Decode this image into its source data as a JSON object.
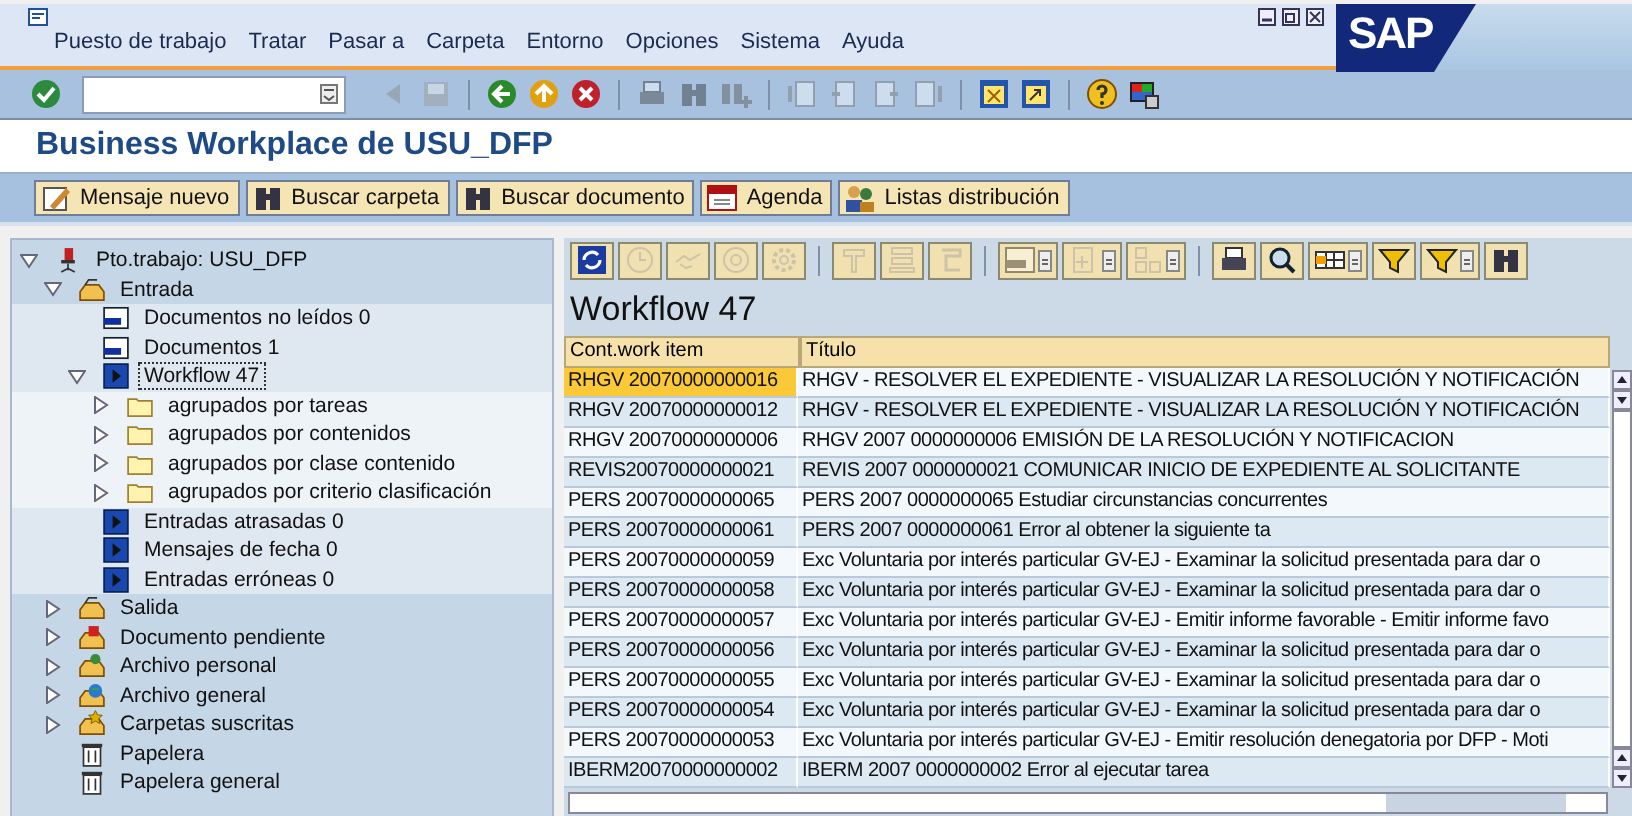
{
  "menu_bar": {
    "items": [
      "Puesto de trabajo",
      "Tratar",
      "Pasar a",
      "Carpeta",
      "Entorno",
      "Opciones",
      "Sistema",
      "Ayuda"
    ],
    "logo": "SAP"
  },
  "main_toolbar": [
    {
      "kind": "button",
      "disabled": false
    },
    {
      "kind": "command_field"
    },
    {
      "kind": "button",
      "disabled": true
    },
    {
      "kind": "button",
      "disabled": true
    },
    {
      "kind": "separator"
    },
    {
      "kind": "button",
      "disabled": false
    },
    {
      "kind": "button",
      "disabled": false
    },
    {
      "kind": "button",
      "disabled": false
    },
    {
      "kind": "separator"
    },
    {
      "kind": "button",
      "disabled": true
    },
    {
      "kind": "button",
      "disabled": true
    },
    {
      "kind": "button",
      "disabled": true
    },
    {
      "kind": "separator"
    },
    {
      "kind": "button",
      "disabled": true
    },
    {
      "kind": "button",
      "disabled": true
    },
    {
      "kind": "button",
      "disabled": true
    },
    {
      "kind": "button",
      "disabled": true
    },
    {
      "kind": "separator"
    },
    {
      "kind": "button",
      "disabled": false
    },
    {
      "kind": "button",
      "disabled": false
    },
    {
      "kind": "separator"
    },
    {
      "kind": "button",
      "disabled": false
    },
    {
      "kind": "button",
      "disabled": false
    }
  ],
  "screen_title": "Business Workplace de USU_DFP",
  "app_toolbar": [
    {
      "label": "Mensaje nuevo"
    },
    {
      "label": "Buscar carpeta"
    },
    {
      "label": "Buscar documento"
    },
    {
      "label": "Agenda"
    },
    {
      "label": "Listas distribución"
    }
  ],
  "tree": [
    {
      "label": "Pto.trabajo: USU_DFP",
      "kind": "workplace",
      "expanded": true,
      "selected": false,
      "children": [
        {
          "label": "Entrada",
          "kind": "inbox",
          "expanded": true,
          "selected": false,
          "children": [
            {
              "label": "Documentos no leídos 0",
              "kind": "document",
              "selected": false
            },
            {
              "label": "Documentos 1",
              "kind": "document",
              "selected": false
            },
            {
              "label": "Workflow 47",
              "kind": "workflow",
              "expanded": true,
              "selected": true,
              "children": [
                {
                  "label": "agrupados por tareas",
                  "kind": "folder",
                  "expanded": false,
                  "selected": false
                },
                {
                  "label": "agrupados por contenidos",
                  "kind": "folder",
                  "expanded": false,
                  "selected": false
                },
                {
                  "label": "agrupados por clase contenido",
                  "kind": "folder",
                  "expanded": false,
                  "selected": false
                },
                {
                  "label": "agrupados por criterio clasificación",
                  "kind": "folder",
                  "expanded": false,
                  "selected": false
                }
              ]
            },
            {
              "label": "Entradas atrasadas 0",
              "kind": "workflow",
              "selected": false
            },
            {
              "label": "Mensajes de fecha 0",
              "kind": "workflow",
              "selected": false
            },
            {
              "label": "Entradas erróneas 0",
              "kind": "workflow",
              "selected": false
            }
          ]
        },
        {
          "label": "Salida",
          "kind": "outbox",
          "expanded": false,
          "selected": false
        },
        {
          "label": "Documento pendiente",
          "kind": "pending",
          "expanded": false,
          "selected": false
        },
        {
          "label": "Archivo personal",
          "kind": "personal",
          "expanded": false,
          "selected": false
        },
        {
          "label": "Archivo general",
          "kind": "general",
          "expanded": false,
          "selected": false
        },
        {
          "label": "Carpetas suscritas",
          "kind": "subscribed",
          "expanded": false,
          "selected": false
        },
        {
          "label": "Papelera",
          "kind": "trash",
          "selected": false
        },
        {
          "label": "Papelera general",
          "kind": "trash",
          "selected": false
        }
      ]
    }
  ],
  "panel": {
    "toolbar": [
      [
        {
          "disabled": false,
          "menu": false
        },
        {
          "disabled": true,
          "menu": false
        },
        {
          "disabled": true,
          "menu": false
        },
        {
          "disabled": true,
          "menu": false
        },
        {
          "disabled": true,
          "menu": false
        }
      ],
      [
        {
          "disabled": true,
          "menu": false
        },
        {
          "disabled": true,
          "menu": false
        },
        {
          "disabled": true,
          "menu": false
        }
      ],
      [
        {
          "disabled": true,
          "menu": true
        },
        {
          "disabled": true,
          "menu": true
        },
        {
          "disabled": true,
          "menu": true
        }
      ],
      [
        {
          "disabled": false,
          "menu": false
        },
        {
          "disabled": false,
          "menu": false
        },
        {
          "disabled": false,
          "menu": true
        },
        {
          "disabled": false,
          "menu": false
        },
        {
          "disabled": false,
          "menu": true
        },
        {
          "disabled": false,
          "menu": false
        }
      ]
    ],
    "title": "Workflow 47",
    "columns": [
      "Cont.work item",
      "Título"
    ],
    "rows": [
      {
        "cells": [
          "RHGV 20070000000016",
          "RHGV - RESOLVER EL EXPEDIENTE - VISUALIZAR LA RESOLUCIÓN Y NOTIFICACIÓN"
        ],
        "selected": true
      },
      {
        "cells": [
          "RHGV 20070000000012",
          "RHGV - RESOLVER EL EXPEDIENTE - VISUALIZAR LA RESOLUCIÓN Y NOTIFICACIÓN"
        ],
        "selected": false
      },
      {
        "cells": [
          "RHGV 20070000000006",
          "RHGV 2007 0000000006 EMISIÓN DE LA RESOLUCIÓN Y NOTIFICACION"
        ],
        "selected": false
      },
      {
        "cells": [
          "REVIS20070000000021",
          "REVIS 2007 0000000021 COMUNICAR INICIO DE EXPEDIENTE AL SOLICITANTE"
        ],
        "selected": false
      },
      {
        "cells": [
          "PERS 20070000000065",
          "PERS 2007 0000000065 Estudiar circunstancias concurrentes"
        ],
        "selected": false
      },
      {
        "cells": [
          "PERS 20070000000061",
          "PERS 2007 0000000061 Error al obtener la siguiente ta"
        ],
        "selected": false
      },
      {
        "cells": [
          "PERS 20070000000059",
          "Exc Voluntaria por interés particular GV-EJ - Examinar la solicitud presentada para dar o"
        ],
        "selected": false
      },
      {
        "cells": [
          "PERS 20070000000058",
          "Exc Voluntaria por interés particular GV-EJ - Examinar la solicitud presentada para dar o"
        ],
        "selected": false
      },
      {
        "cells": [
          "PERS 20070000000057",
          "Exc Voluntaria por interés particular GV-EJ - Emitir informe favorable - Emitir informe favo"
        ],
        "selected": false
      },
      {
        "cells": [
          "PERS 20070000000056",
          "Exc Voluntaria por interés particular GV-EJ - Examinar la solicitud presentada para dar o"
        ],
        "selected": false
      },
      {
        "cells": [
          "PERS 20070000000055",
          "Exc Voluntaria por interés particular GV-EJ - Examinar la solicitud presentada para dar o"
        ],
        "selected": false
      },
      {
        "cells": [
          "PERS 20070000000054",
          "Exc Voluntaria por interés particular GV-EJ - Examinar la solicitud presentada para dar o"
        ],
        "selected": false
      },
      {
        "cells": [
          "PERS 20070000000053",
          "Exc Voluntaria por interés particular GV-EJ - Emitir resolución denegatoria por DFP - Moti"
        ],
        "selected": false
      },
      {
        "cells": [
          "IBERM20070000000002",
          "IBERM 2007 0000000002 Error al ejecutar tarea"
        ],
        "selected": false
      }
    ]
  }
}
